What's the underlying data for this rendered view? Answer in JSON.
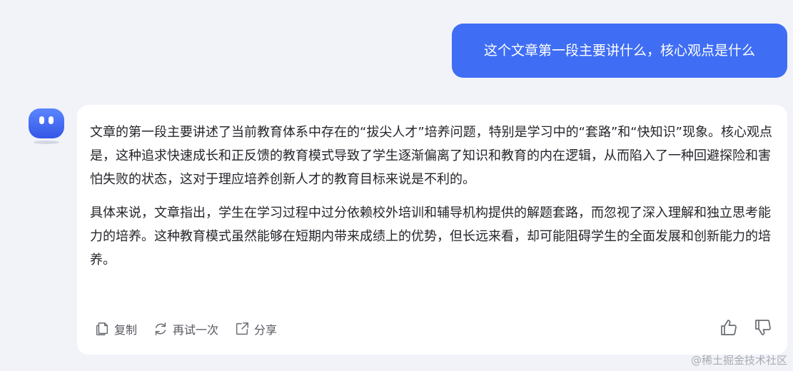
{
  "user_message": {
    "text": "这个文章第一段主要讲什么，核心观点是什么"
  },
  "assistant": {
    "avatar_icon": "robot-face-icon",
    "paragraphs": [
      "文章的第一段主要讲述了当前教育体系中存在的“拔尖人才”培养问题，特别是学习中的“套路”和“快知识”现象。核心观点是，这种追求快速成长和正反馈的教育模式导致了学生逐渐偏离了知识和教育的内在逻辑，从而陷入了一种回避探险和害怕失败的状态，这对于理应培养创新人才的教育目标来说是不利的。",
      "具体来说，文章指出，学生在学习过程中过分依赖校外培训和辅导机构提供的解题套路，而忽视了深入理解和独立思考能力的培养。这种教育模式虽然能够在短期内带来成绩上的优势，但长远来看，却可能阻碍学生的全面发展和创新能力的培养。"
    ],
    "actions": {
      "copy_label": "复制",
      "retry_label": "再试一次",
      "share_label": "分享"
    }
  },
  "watermark": "@稀土掘金技术社区",
  "colors": {
    "background": "#f2f3f9",
    "user_bubble": "#3f6ef4",
    "card": "#ffffff",
    "text": "#24252b",
    "action_text": "#55575f"
  }
}
